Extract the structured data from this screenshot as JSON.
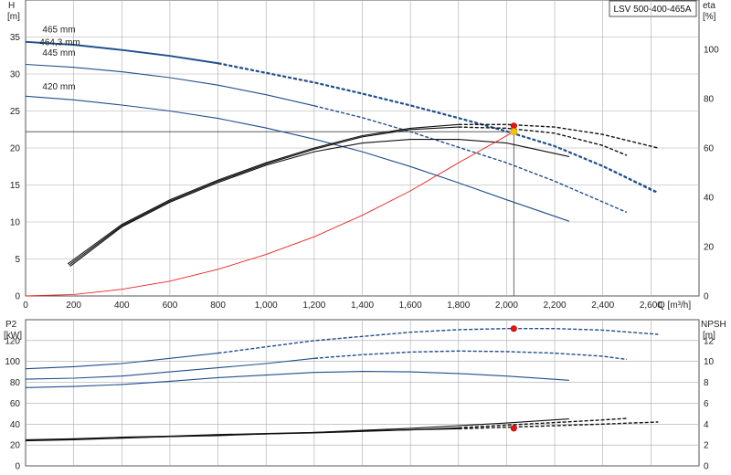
{
  "title": "LSV 500-400-465A",
  "colors": {
    "impeller": "#1f4e8c",
    "efficiency": "#111111",
    "system": "#ee2222",
    "operating_point": "#ee1111",
    "duty_point": "#f5c400",
    "grid": "#aaaaaa",
    "axis": "#555555"
  },
  "chart_data": [
    {
      "id": "head",
      "type": "line",
      "xlabel": "Q [m³/h]",
      "ylabel_left_top": "H",
      "ylabel_left_unit": "[m]",
      "ylabel_right_top": "eta",
      "ylabel_right_unit": "[%]",
      "xlim": [
        0,
        2800
      ],
      "ylim_left": [
        0,
        40
      ],
      "ylim_right": [
        0,
        120
      ],
      "xticks": [
        0,
        200,
        400,
        600,
        800,
        1000,
        1200,
        1400,
        1600,
        1800,
        2000,
        2200,
        2400,
        2600
      ],
      "xtick_labels": [
        "0",
        "200",
        "400",
        "600",
        "800",
        "1,000",
        "1,200",
        "1,400",
        "1,600",
        "1,800",
        "2,000",
        "2,200",
        "2,400",
        "2,600"
      ],
      "yticks_left": [
        0,
        5,
        10,
        15,
        20,
        25,
        30,
        35
      ],
      "yticks_right": [
        0,
        20,
        40,
        60,
        80,
        100
      ],
      "grid": true,
      "reference_lines": {
        "h": 22.2,
        "q": 2030
      },
      "series": [
        {
          "name": "465 mm",
          "axis": "left",
          "color": "impeller",
          "solid_end": 800,
          "x": [
            0,
            200,
            400,
            600,
            800,
            1000,
            1200,
            1400,
            1600,
            1800,
            2000,
            2200,
            2400,
            2630
          ],
          "y": [
            34.4,
            34.0,
            33.3,
            32.5,
            31.5,
            30.2,
            28.9,
            27.4,
            25.8,
            24.1,
            22.3,
            20.3,
            17.6,
            14.0
          ]
        },
        {
          "name": "464,3 mm",
          "axis": "left",
          "color": "impeller",
          "solid_end": 800,
          "x": [
            0,
            200,
            400,
            600,
            800,
            1000,
            1200,
            1400,
            1600,
            1800,
            2000,
            2200,
            2400,
            2620
          ],
          "y": [
            34.3,
            33.9,
            33.2,
            32.4,
            31.4,
            30.1,
            28.8,
            27.3,
            25.7,
            24.0,
            22.2,
            20.2,
            17.5,
            14.0
          ]
        },
        {
          "name": "445 mm",
          "axis": "left",
          "color": "impeller",
          "solid_end": 1300,
          "x": [
            0,
            200,
            400,
            600,
            800,
            1000,
            1200,
            1400,
            1600,
            1800,
            2000,
            2200,
            2400,
            2500
          ],
          "y": [
            31.3,
            30.9,
            30.3,
            29.5,
            28.5,
            27.2,
            25.7,
            24.1,
            22.2,
            20.1,
            18.0,
            15.5,
            12.7,
            11.3
          ]
        },
        {
          "name": "420 mm",
          "axis": "left",
          "color": "impeller",
          "solid_end": 2260,
          "x": [
            0,
            200,
            400,
            600,
            800,
            1000,
            1200,
            1400,
            1600,
            1800,
            2000,
            2260
          ],
          "y": [
            27.0,
            26.5,
            25.8,
            25.0,
            24.0,
            22.7,
            21.2,
            19.5,
            17.5,
            15.3,
            13.0,
            10.1
          ]
        },
        {
          "name": "",
          "axis": "right",
          "color": "efficiency",
          "solid_end": 1800,
          "x": [
            175,
            400,
            600,
            800,
            1000,
            1200,
            1400,
            1600,
            1800,
            2000,
            2200,
            2400,
            2630
          ],
          "y": [
            13,
            29,
            39,
            47,
            54,
            60,
            65,
            68,
            69.5,
            69.5,
            68.5,
            65.5,
            60
          ]
        },
        {
          "name": "",
          "axis": "right",
          "color": "efficiency",
          "solid_end": 1800,
          "x": [
            180,
            400,
            600,
            800,
            1000,
            1200,
            1400,
            1600,
            1800,
            2000,
            2200,
            2400,
            2500
          ],
          "y": [
            12.5,
            28.5,
            38.5,
            46.5,
            53.5,
            59.5,
            64.5,
            67.5,
            68.5,
            68.0,
            66.0,
            61.0,
            57.0
          ]
        },
        {
          "name": "",
          "axis": "right",
          "color": "efficiency",
          "solid_end": 2260,
          "x": [
            185,
            400,
            600,
            800,
            1000,
            1200,
            1400,
            1600,
            1800,
            2000,
            2260
          ],
          "y": [
            12,
            28,
            38,
            46,
            53,
            58.5,
            62,
            63.5,
            63.5,
            62,
            56.5
          ]
        },
        {
          "name": "",
          "axis": "left",
          "color": "system",
          "solid_end": 2030,
          "x": [
            0,
            200,
            400,
            600,
            800,
            1000,
            1200,
            1400,
            1600,
            1800,
            2030
          ],
          "y": [
            0,
            0.2,
            0.9,
            2.0,
            3.6,
            5.6,
            8.0,
            10.9,
            14.2,
            18.0,
            22.2
          ]
        }
      ],
      "points": [
        {
          "x": 2030,
          "y": 23.0,
          "axis": "left",
          "color": "operating_point"
        },
        {
          "x": 2030,
          "y": 22.2,
          "axis": "left",
          "color": "duty_point"
        }
      ],
      "curve_labels": [
        {
          "text": "465 mm",
          "x": 70,
          "y": 35.6
        },
        {
          "text": "464,3 mm",
          "x": 58,
          "y": 33.9
        },
        {
          "text": "445 mm",
          "x": 70,
          "y": 32.5
        },
        {
          "text": "420 mm",
          "x": 70,
          "y": 27.9
        }
      ]
    },
    {
      "id": "power",
      "type": "line",
      "ylabel_left_top": "P2",
      "ylabel_left_unit": "[kW]",
      "ylabel_right_top": "NPSH",
      "ylabel_right_unit": "[m]",
      "xlim": [
        0,
        2800
      ],
      "ylim_left": [
        0,
        140
      ],
      "ylim_right": [
        0,
        14
      ],
      "yticks_left": [
        0,
        20,
        40,
        60,
        80,
        100,
        120
      ],
      "yticks_right": [
        0,
        2,
        4,
        6,
        8,
        10,
        12
      ],
      "grid": true,
      "series": [
        {
          "name": "",
          "axis": "left",
          "color": "impeller",
          "solid_end": 800,
          "x": [
            0,
            200,
            400,
            600,
            800,
            1000,
            1200,
            1400,
            1600,
            1800,
            2000,
            2200,
            2400,
            2630
          ],
          "y": [
            93,
            95,
            98,
            103,
            108,
            114,
            120,
            124,
            128,
            130.5,
            131.5,
            131.5,
            130,
            126
          ]
        },
        {
          "name": "",
          "axis": "left",
          "color": "impeller",
          "solid_end": 1300,
          "x": [
            0,
            200,
            400,
            600,
            800,
            1000,
            1200,
            1400,
            1600,
            1800,
            2000,
            2200,
            2400,
            2500
          ],
          "y": [
            83,
            84,
            86,
            90,
            94,
            98,
            103,
            106.5,
            109,
            110,
            109.5,
            108,
            105,
            102
          ]
        },
        {
          "name": "",
          "axis": "left",
          "color": "impeller",
          "solid_end": 2260,
          "x": [
            0,
            200,
            400,
            600,
            800,
            1000,
            1200,
            1400,
            1600,
            1800,
            2000,
            2260
          ],
          "y": [
            75,
            76,
            78,
            81,
            84.5,
            87,
            89.5,
            90.5,
            90,
            88.5,
            86,
            82
          ]
        },
        {
          "name": "",
          "axis": "right",
          "color": "efficiency",
          "solid_end": 1800,
          "x": [
            0,
            200,
            400,
            600,
            800,
            1000,
            1200,
            1400,
            1600,
            1800,
            2000,
            2200,
            2400,
            2630
          ],
          "y": [
            2.5,
            2.6,
            2.75,
            2.85,
            3.0,
            3.1,
            3.2,
            3.35,
            3.45,
            3.55,
            3.7,
            3.85,
            4.0,
            4.2
          ]
        },
        {
          "name": "",
          "axis": "right",
          "color": "efficiency",
          "solid_end": 1800,
          "x": [
            0,
            200,
            400,
            600,
            800,
            1000,
            1200,
            1400,
            1600,
            1800,
            2000,
            2200,
            2400,
            2500
          ],
          "y": [
            2.45,
            2.55,
            2.7,
            2.8,
            2.95,
            3.05,
            3.15,
            3.3,
            3.45,
            3.65,
            3.9,
            4.15,
            4.4,
            4.55
          ]
        },
        {
          "name": "",
          "axis": "right",
          "color": "efficiency",
          "solid_end": 2260,
          "x": [
            0,
            200,
            400,
            600,
            800,
            1000,
            1200,
            1400,
            1600,
            1800,
            2000,
            2260
          ],
          "y": [
            2.4,
            2.5,
            2.65,
            2.8,
            2.9,
            3.05,
            3.2,
            3.4,
            3.6,
            3.85,
            4.1,
            4.5
          ]
        }
      ],
      "points": [
        {
          "x": 2030,
          "y": 131.5,
          "axis": "left",
          "color": "operating_point"
        },
        {
          "x": 2030,
          "y": 3.6,
          "axis": "right",
          "color": "operating_point"
        }
      ]
    }
  ]
}
